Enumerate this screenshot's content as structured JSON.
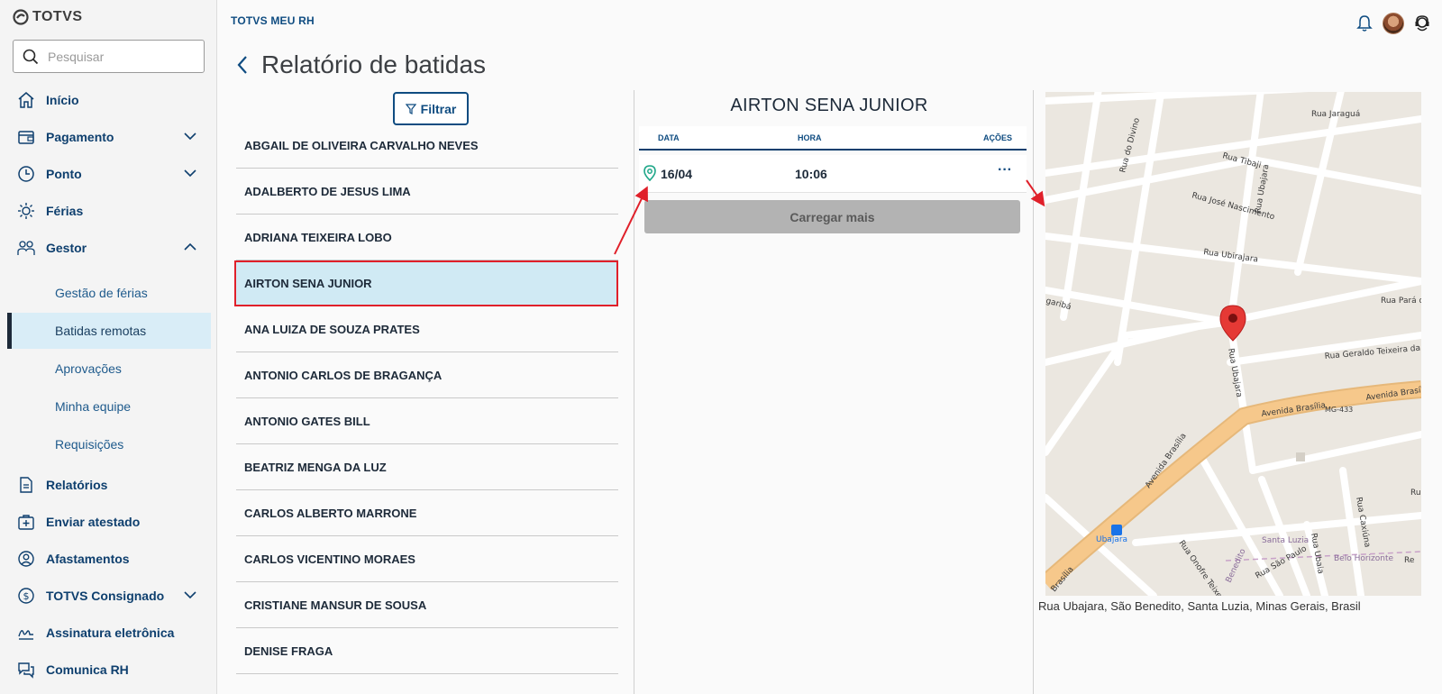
{
  "app": {
    "logo_text": "TOTVS",
    "brand": "TOTVS MEU RH"
  },
  "search": {
    "placeholder": "Pesquisar"
  },
  "sidebar": {
    "items": [
      {
        "label": "Início",
        "icon": "home-icon"
      },
      {
        "label": "Pagamento",
        "icon": "wallet-icon",
        "expandable": true
      },
      {
        "label": "Ponto",
        "icon": "clock-icon",
        "expandable": true
      },
      {
        "label": "Férias",
        "icon": "sun-icon"
      },
      {
        "label": "Gestor",
        "icon": "team-icon",
        "expandable": true,
        "expanded": true
      },
      {
        "label": "Relatórios",
        "icon": "report-icon"
      },
      {
        "label": "Enviar atestado",
        "icon": "medical-bag-icon"
      },
      {
        "label": "Afastamentos",
        "icon": "user-away-icon"
      },
      {
        "label": "TOTVS Consignado",
        "icon": "dollar-circle-icon",
        "expandable": true
      },
      {
        "label": "Assinatura eletrônica",
        "icon": "signature-icon"
      },
      {
        "label": "Comunica RH",
        "icon": "chat-icon"
      }
    ],
    "gestor_sub": [
      {
        "label": "Gestão de férias"
      },
      {
        "label": "Batidas remotas",
        "active": true
      },
      {
        "label": "Aprovações"
      },
      {
        "label": "Minha equipe"
      },
      {
        "label": "Requisições"
      }
    ]
  },
  "page": {
    "title": "Relatório de batidas",
    "filter_label": "Filtrar"
  },
  "employees": [
    "ABGAIL DE OLIVEIRA CARVALHO NEVES",
    "ADALBERTO DE JESUS LIMA",
    "ADRIANA TEIXEIRA LOBO",
    "AIRTON SENA JUNIOR",
    "ANA LUIZA DE SOUZA PRATES",
    "ANTONIO CARLOS DE BRAGANÇA",
    "ANTONIO GATES BILL",
    "BEATRIZ MENGA DA LUZ",
    "CARLOS ALBERTO MARRONE",
    "CARLOS VICENTINO MORAES",
    "CRISTIANE MANSUR DE SOUSA",
    "DENISE FRAGA"
  ],
  "selected_employee_index": 3,
  "detail": {
    "name": "AIRTON SENA JUNIOR",
    "columns": {
      "date": "DATA",
      "time": "HORA",
      "actions": "AÇÕES"
    },
    "records": [
      {
        "date": "16/04",
        "time": "10:06",
        "actions": "···"
      }
    ],
    "load_more": "Carregar mais"
  },
  "map": {
    "streets": [
      "Rua Jaraguá",
      "Rua do Divino",
      "Rua Tibaji",
      "Rua José Nascimento",
      "Rua Ubajara",
      "Rua Ubirajara",
      "Rua Pará d",
      "garibá",
      "Rua Geraldo Teixeira da C",
      "Rua Ubajara",
      "Avenida Brasília",
      "Avenida Brasília",
      "MG-433",
      "Avenida Brasília",
      "Rua Onofre Teixeira",
      "Rua Caxiúna",
      "Rua M",
      "Rua Ubaia",
      "Santa Luzia",
      "Rua São Paulo",
      "Belo Horizonte",
      "Benedito",
      "Ubajara",
      "Brasília",
      "Re"
    ],
    "address": "Rua Ubajara, São Benedito, Santa Luzia, Minas Gerais, Brasil"
  },
  "colors": {
    "primary": "#0f4c81",
    "highlight": "#d0eaf4",
    "annotation": "#e0202a",
    "road_major": "#f6c88b",
    "pin": "#e53935"
  }
}
